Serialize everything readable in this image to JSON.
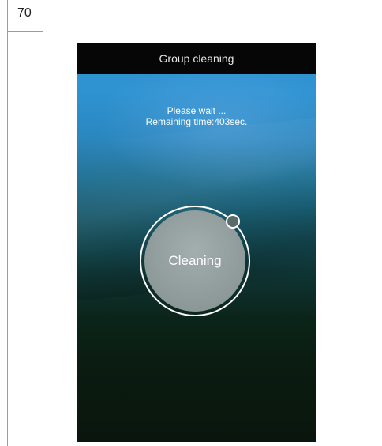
{
  "page": {
    "number": "70"
  },
  "app": {
    "title": "Group cleaning",
    "status": {
      "wait_text": "Please wait ...",
      "remaining_text": "Remaining time:403sec."
    },
    "button": {
      "label": "Cleaning"
    }
  }
}
